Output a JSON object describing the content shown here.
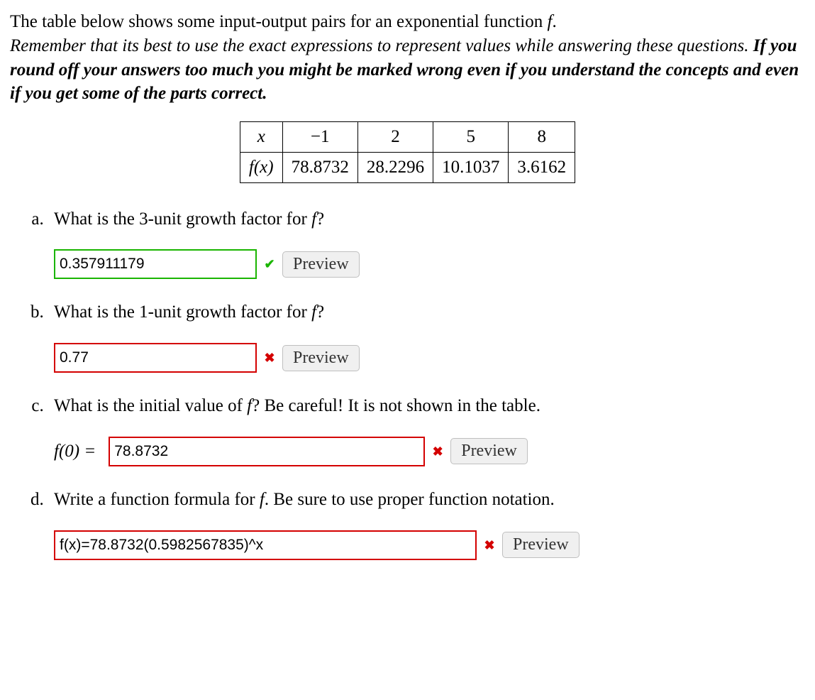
{
  "intro": {
    "line1_before": "The table below shows some input-output pairs for an exponential function ",
    "line1_fn": "f",
    "line1_after": ".",
    "line2_italic": "Remember that its best to use the exact expressions to represent values while answering these questions. ",
    "line3_bold": "If you round off your answers too much you might be marked wrong even if you understand the concepts and even if you get some of the parts correct."
  },
  "table": {
    "header_x": "x",
    "header_fx": "f(x)",
    "cols": [
      "−1",
      "2",
      "5",
      "8"
    ],
    "vals": [
      "78.8732",
      "28.2296",
      "10.1037",
      "3.6162"
    ]
  },
  "questions": {
    "a": {
      "text_before": "What is the 3-unit growth factor for ",
      "fn": "f",
      "text_after": "?",
      "value": "0.357911179",
      "status": "correct"
    },
    "b": {
      "text_before": "What is the 1-unit growth factor for ",
      "fn": "f",
      "text_after": "?",
      "value": "0.77",
      "status": "wrong"
    },
    "c": {
      "text_before": "What is the initial value of ",
      "fn": "f",
      "text_after": "? ",
      "hint": "Be careful! It is not shown in the table.",
      "label": "f(0) = ",
      "value": "78.8732",
      "status": "wrong"
    },
    "d": {
      "text_before": "Write a function formula for ",
      "fn": "f",
      "text_after": ". Be sure to use proper function notation.",
      "value": "f(x)=78.8732(0.5982567835)^x",
      "status": "wrong"
    }
  },
  "buttons": {
    "preview": "Preview"
  },
  "icons": {
    "correct": "✔",
    "wrong": "✖"
  }
}
